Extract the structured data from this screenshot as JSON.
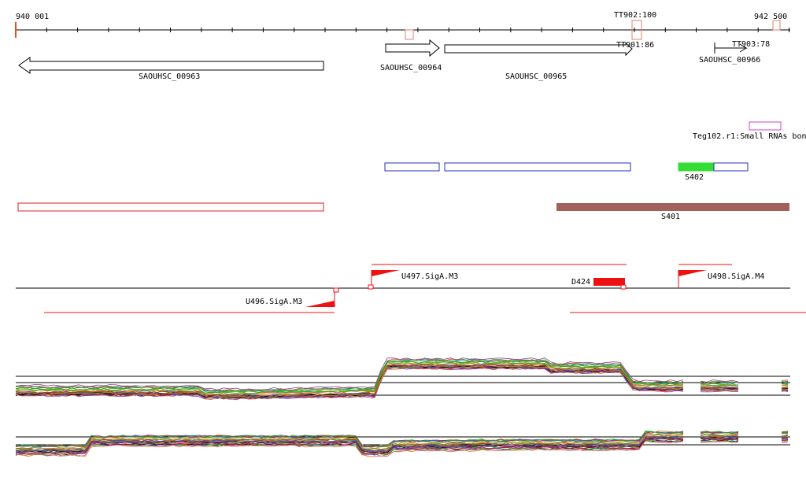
{
  "axis": {
    "start_label": "940 001",
    "end_label": "942 500",
    "terminators": [
      {
        "label": "TT902:100"
      },
      {
        "label": "TT901:86"
      },
      {
        "label": "TT903:78"
      }
    ]
  },
  "genes": [
    {
      "name": "SAOUHSC_00963",
      "strand": "-"
    },
    {
      "name": "SAOUHSC_00964",
      "strand": "+"
    },
    {
      "name": "SAOUHSC_00965",
      "strand": "+"
    },
    {
      "name": "SAOUHSC_00966",
      "strand": "+"
    }
  ],
  "small_rna": {
    "label": "Teg102.r1:Small RNAs bon"
  },
  "segments": [
    {
      "label": "S402"
    },
    {
      "label": "S401"
    }
  ],
  "promoters": [
    {
      "label": "U497.SigA.M3"
    },
    {
      "label": "U496.SigA.M3"
    },
    {
      "label": "U498.SigA.M4"
    },
    {
      "label": "D424"
    }
  ],
  "colors": {
    "axis_start": "#e85020",
    "gene": "#000000",
    "terminator_box": "#e08070",
    "small_rna": "#cc44cc",
    "expressed_box": "#2233bb",
    "s402_fill": "#33dd33",
    "s401_fill": "#a0625a",
    "red_box": "#dd2222",
    "promoter": "#ee1111"
  }
}
